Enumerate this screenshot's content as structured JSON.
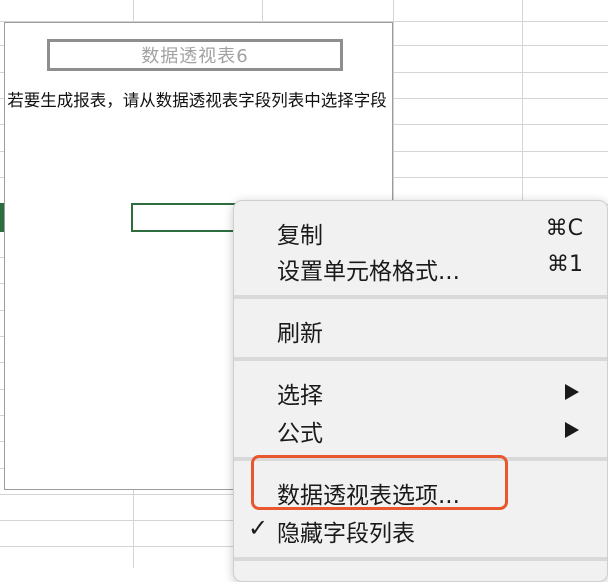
{
  "pivot": {
    "title": "数据透视表6",
    "hint": "若要生成报表，请从数据透视表字段列表中选择字段"
  },
  "context_menu": {
    "items": [
      {
        "label": "复制",
        "shortcut": "⌘C"
      },
      {
        "label": "设置单元格格式...",
        "shortcut": "⌘1"
      },
      {
        "label": "刷新"
      },
      {
        "label": "选择",
        "submenu": true
      },
      {
        "label": "公式",
        "submenu": true
      },
      {
        "label": "数据透视表选项..."
      },
      {
        "label": "隐藏字段列表",
        "checked": true,
        "check_icon": "✓"
      }
    ]
  },
  "colors": {
    "selection": "#2e6e3e",
    "annotation": "#e8572e",
    "menu_bg": "#f1f1f1"
  }
}
